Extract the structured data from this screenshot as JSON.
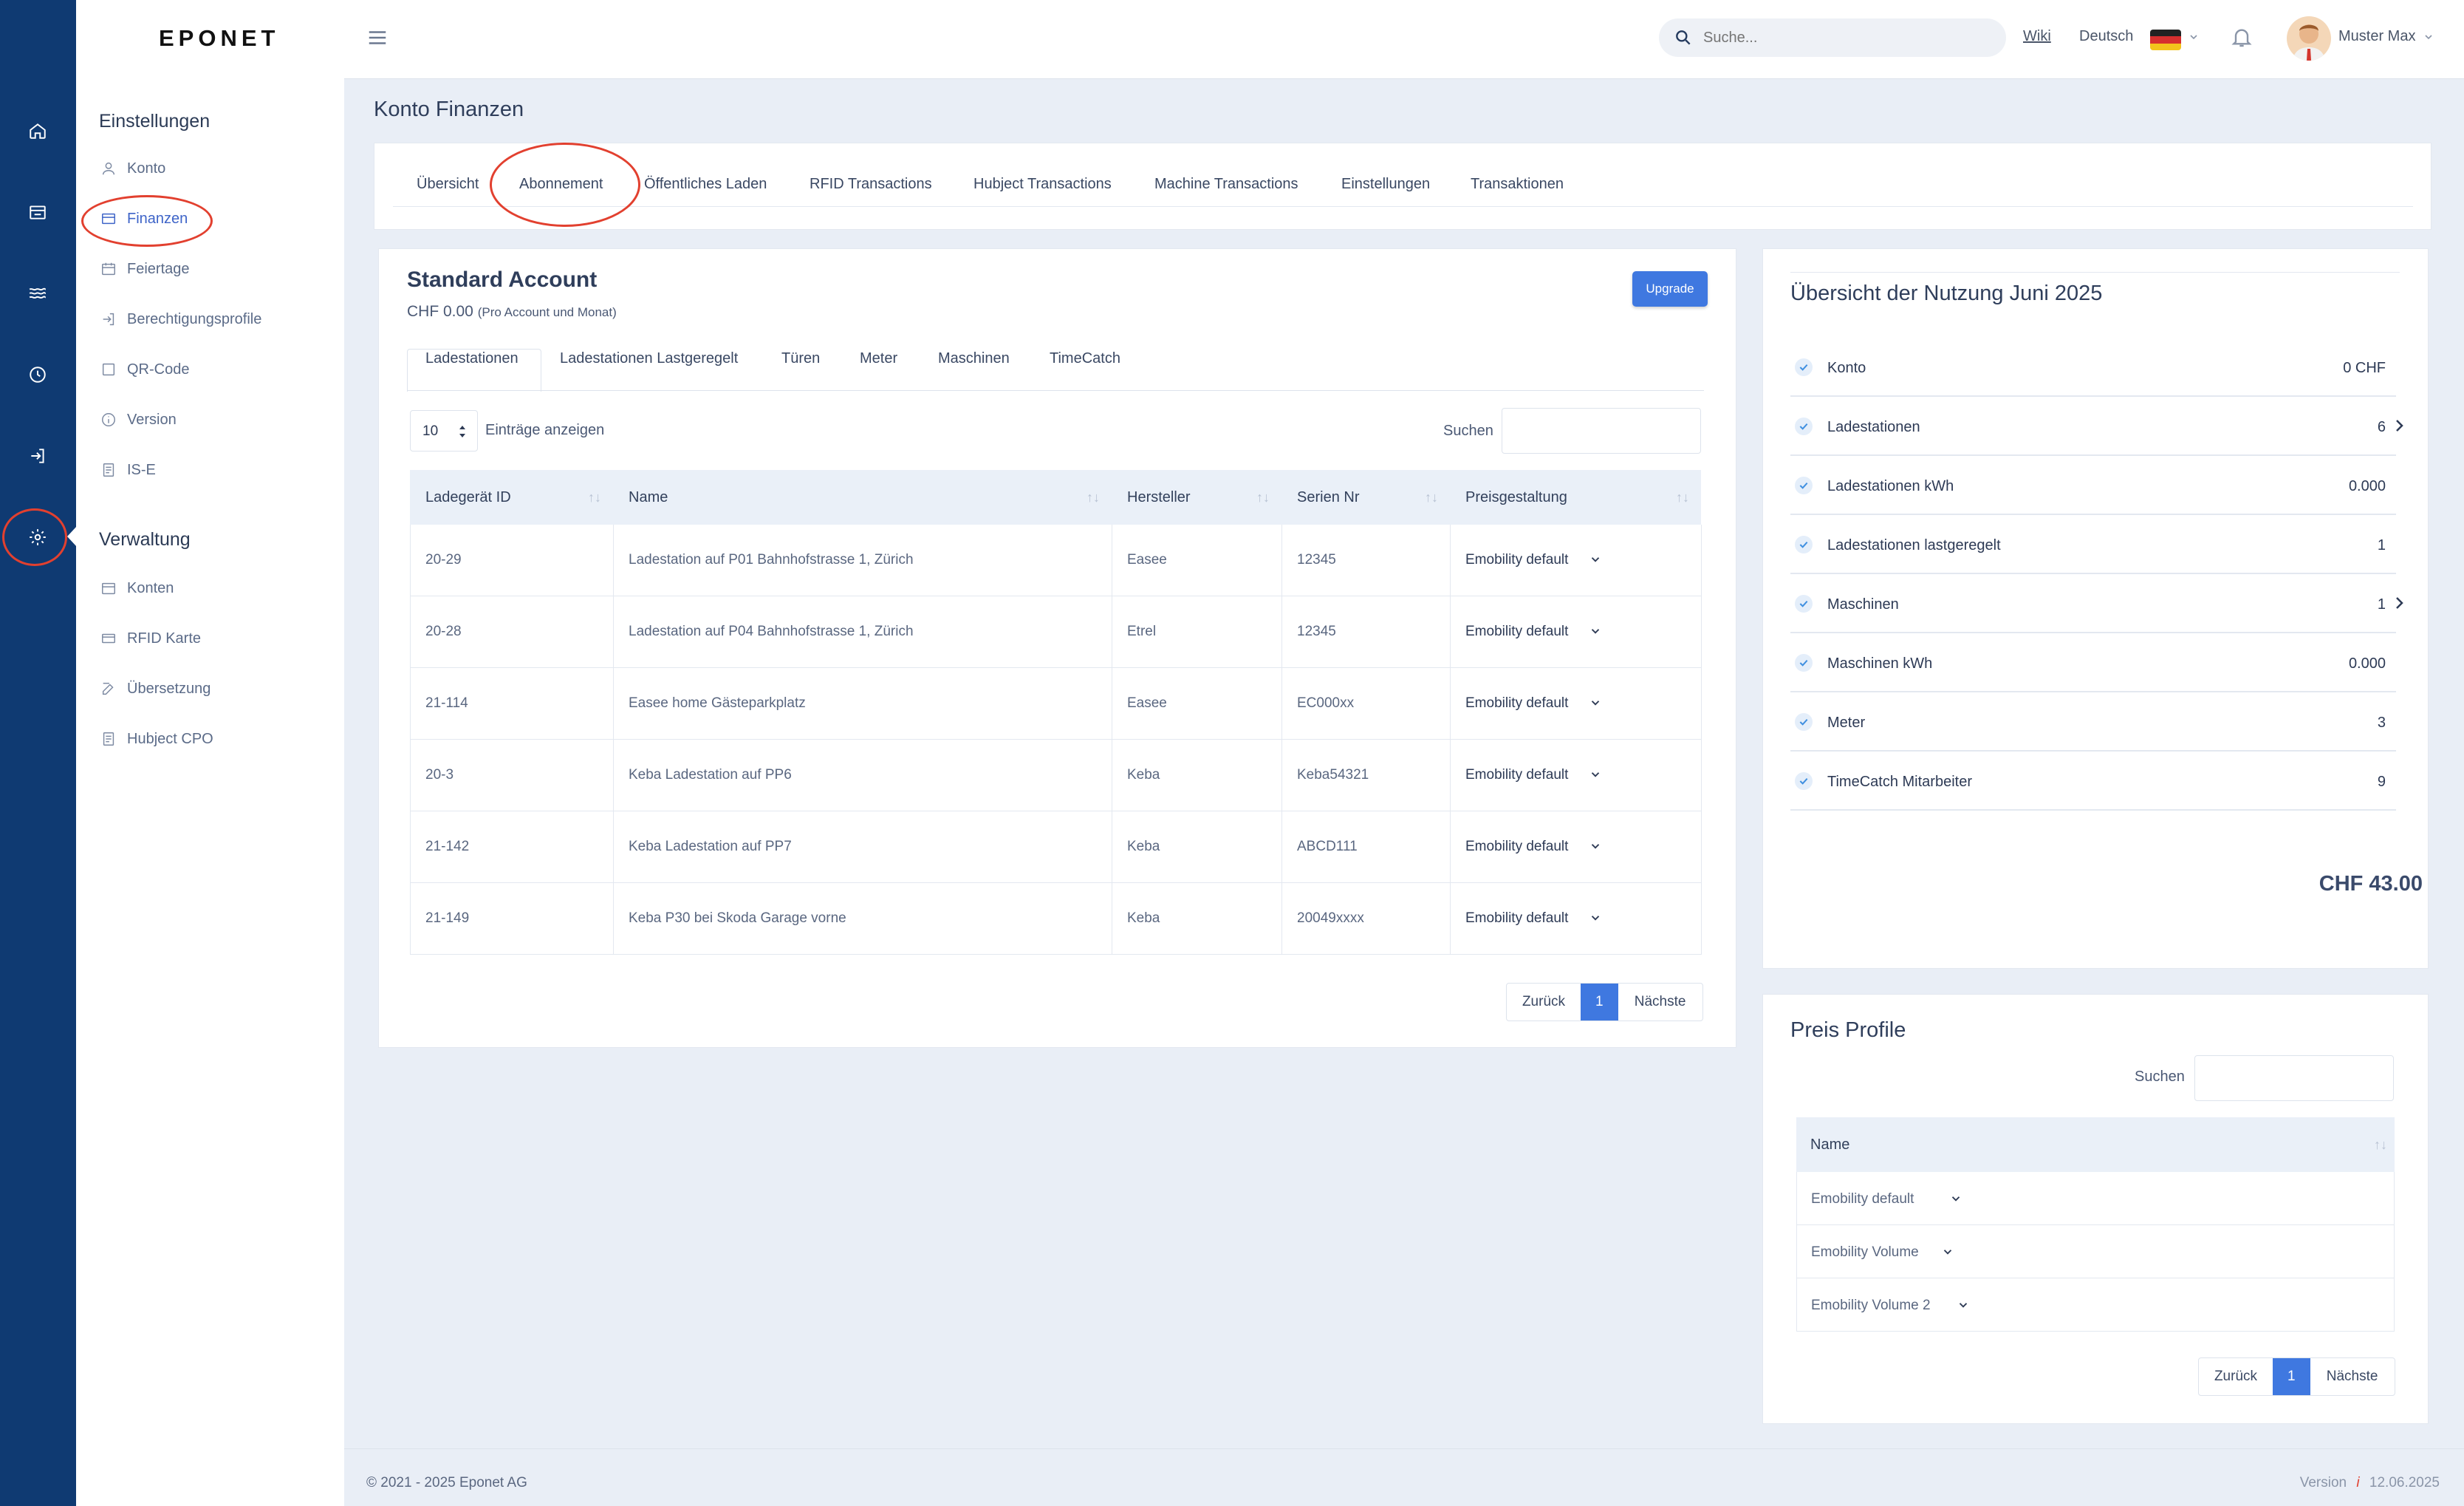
{
  "brand": {
    "logo": "EPONET"
  },
  "colors": {
    "rail": "#0f3a72",
    "accent": "#3f78e0",
    "annotation_circle": "#e2402f"
  },
  "rail_icons": [
    "home-icon",
    "store-icon",
    "waves-icon",
    "clock-icon",
    "login-icon",
    "settings-icon"
  ],
  "sidebar": {
    "section1": "Einstellungen",
    "items1": [
      {
        "label": "Konto",
        "icon": "user-icon"
      },
      {
        "label": "Finanzen",
        "icon": "card-icon"
      },
      {
        "label": "Feiertage",
        "icon": "calendar-icon"
      },
      {
        "label": "Berechtigungsprofile",
        "icon": "login-icon"
      },
      {
        "label": "QR-Code",
        "icon": "square-icon"
      },
      {
        "label": "Version",
        "icon": "info-icon"
      },
      {
        "label": "IS-E",
        "icon": "document-icon"
      }
    ],
    "section2": "Verwaltung",
    "items2": [
      {
        "label": "Konten",
        "icon": "calendar-icon"
      },
      {
        "label": "RFID Karte",
        "icon": "card-icon"
      },
      {
        "label": "Übersetzung",
        "icon": "edit-icon"
      },
      {
        "label": "Hubject CPO",
        "icon": "document-icon"
      }
    ]
  },
  "topbar": {
    "search_placeholder": "Suche...",
    "wiki": "Wiki",
    "language": "Deutsch",
    "user_name": "Muster Max"
  },
  "page": {
    "title": "Konto Finanzen"
  },
  "main_tabs": [
    "Übersicht",
    "Abonnement",
    "Öffentliches Laden",
    "RFID Transactions",
    "Hubject Transactions",
    "Machine Transactions",
    "Einstellungen",
    "Transaktionen"
  ],
  "account": {
    "title": "Standard Account",
    "price": "CHF 0.00",
    "price_note": "(Pro Account und Monat)",
    "upgrade_label": "Upgrade"
  },
  "inner_tabs": [
    "Ladestationen",
    "Ladestationen Lastgeregelt",
    "Türen",
    "Meter",
    "Maschinen",
    "TimeCatch"
  ],
  "table_controls": {
    "entries_value": "10",
    "entries_label": "Einträge anzeigen",
    "search_label": "Suchen"
  },
  "stations_table": {
    "columns": [
      "Ladegerät ID",
      "Name",
      "Hersteller",
      "Serien Nr",
      "Preisgestaltung"
    ],
    "rows": [
      [
        "20-29",
        "Ladestation auf P01 Bahnhofstrasse 1, Zürich",
        "Easee",
        "12345",
        "Emobility default"
      ],
      [
        "20-28",
        "Ladestation auf P04 Bahnhofstrasse 1, Zürich",
        "Etrel",
        "12345",
        "Emobility default"
      ],
      [
        "21-114",
        "Easee home Gästeparkplatz",
        "Easee",
        "EC000xx",
        "Emobility default"
      ],
      [
        "20-3",
        "Keba Ladestation auf PP6",
        "Keba",
        "Keba54321",
        "Emobility default"
      ],
      [
        "21-142",
        "Keba Ladestation auf PP7",
        "Keba",
        "ABCD111",
        "Emobility default"
      ],
      [
        "21-149",
        "Keba P30 bei Skoda Garage vorne",
        "Keba",
        "20049xxxx",
        "Emobility default"
      ]
    ]
  },
  "pagination": {
    "prev": "Zurück",
    "current": "1",
    "next": "Nächste"
  },
  "usage": {
    "title": "Übersicht der Nutzung Juni 2025",
    "rows": [
      {
        "label": "Konto",
        "value": "0 CHF"
      },
      {
        "label": "Ladestationen",
        "value": "6"
      },
      {
        "label": "Ladestationen kWh",
        "value": "0.000"
      },
      {
        "label": "Ladestationen lastgeregelt",
        "value": "1"
      },
      {
        "label": "Maschinen",
        "value": "1"
      },
      {
        "label": "Maschinen kWh",
        "value": "0.000"
      },
      {
        "label": "Meter",
        "value": "3"
      },
      {
        "label": "TimeCatch Mitarbeiter",
        "value": "9"
      }
    ],
    "total": "CHF 43.00"
  },
  "price_profiles": {
    "title": "Preis Profile",
    "search_label": "Suchen",
    "column": "Name",
    "rows": [
      "Emobility default",
      "Emobility Volume",
      "Emobility Volume 2"
    ]
  },
  "footer": {
    "copyright": "© 2021 - 2025 Eponet AG",
    "version_label": "Version",
    "version_sep": "i",
    "version_date": "12.06.2025"
  }
}
